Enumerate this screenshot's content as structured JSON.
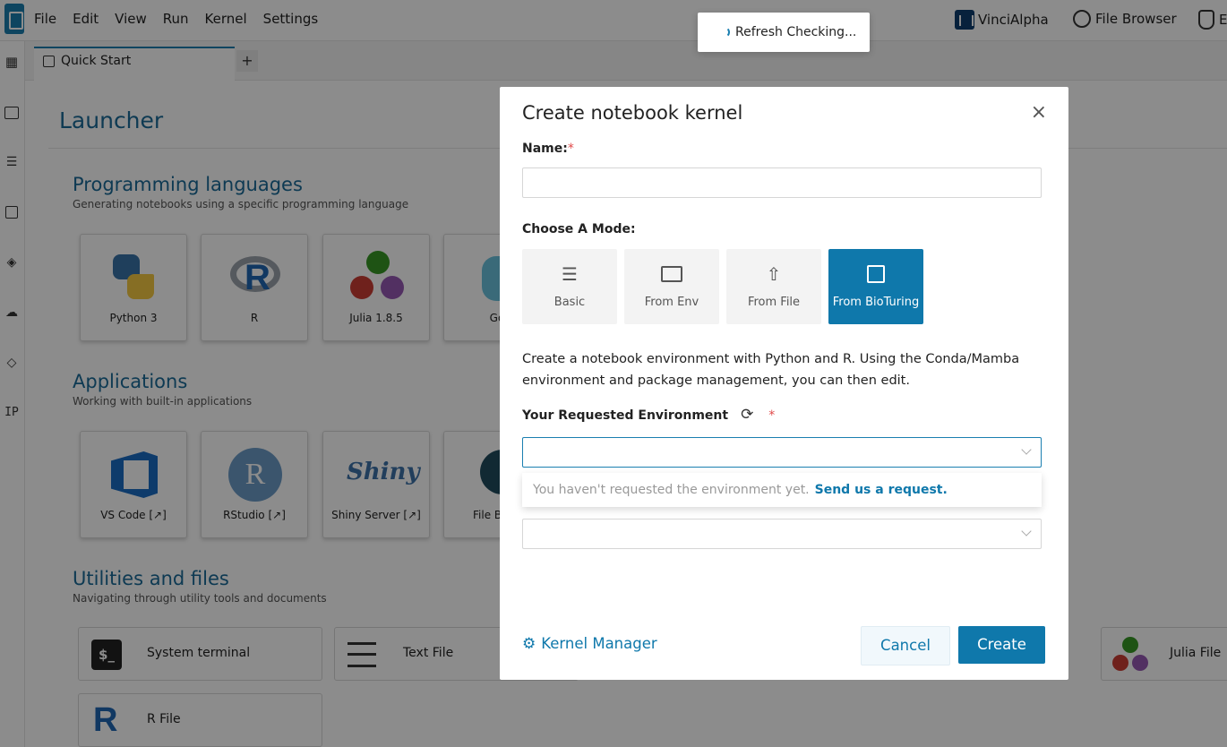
{
  "menubar": {
    "items": [
      "File",
      "Edit",
      "View",
      "Run",
      "Kernel",
      "Settings"
    ],
    "right": {
      "vinci": "VinciAlpha",
      "file_browser": "File Browser",
      "third": "E"
    }
  },
  "toast": {
    "text": "Refresh Checking..."
  },
  "tabs": {
    "active": "Quick Start",
    "add": "+"
  },
  "sidebar": {
    "ip": "IP"
  },
  "launcher": {
    "title": "Launcher",
    "sections": [
      {
        "title": "Programming languages",
        "subtitle": "Generating notebooks using a specific programming language",
        "cards": [
          "Python 3",
          "R",
          "Julia 1.8.5",
          "Go"
        ]
      },
      {
        "title": "Applications",
        "subtitle": "Working with built-in applications",
        "cards": [
          "VS Code [↗]",
          "RStudio [↗]",
          "Shiny Server [↗]",
          "File Brow"
        ]
      },
      {
        "title": "Utilities and files",
        "subtitle": "Navigating through utility tools and documents",
        "cards": [
          "System terminal",
          "Text File",
          "Julia File",
          "R File"
        ]
      }
    ],
    "icon_text": {
      "r": "R",
      "rstudio": "R",
      "shiny": "Shiny",
      "terminal": "$_",
      "rfile": "R"
    }
  },
  "modal": {
    "title": "Create notebook kernel",
    "close": "×",
    "name_label": "Name:",
    "required": "*",
    "mode_label": "Choose A Mode:",
    "modes": [
      "Basic",
      "From Env",
      "From File",
      "From BioTuring"
    ],
    "description": "Create a notebook environment with Python and R. Using the Conda/Mamba environment and package management, you can then edit.",
    "env_label": "Your Requested Environment",
    "hint_text": "You haven't requested the environment yet.",
    "hint_link": "Send us a request.",
    "kernel_manager": "Kernel Manager",
    "cancel": "Cancel",
    "create": "Create"
  }
}
